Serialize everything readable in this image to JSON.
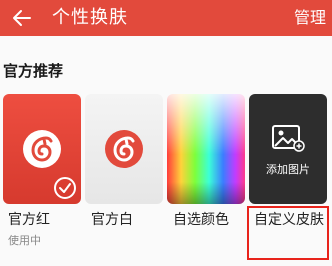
{
  "appbar": {
    "title": "个性换肤",
    "manage_label": "管理",
    "back_icon": "arrow-left-icon",
    "background_color": "#e24a3c"
  },
  "section": {
    "title": "官方推荐"
  },
  "skins": [
    {
      "label": "官方红",
      "status": "使用中",
      "selected": true,
      "icon": "netease-music-logo-icon"
    },
    {
      "label": "官方白",
      "icon": "netease-music-logo-icon"
    },
    {
      "label": "自选颜色",
      "icon": "color-spectrum"
    },
    {
      "label": "自定义皮肤",
      "action_label": "添加图片",
      "icon": "add-image-icon"
    }
  ],
  "colors": {
    "brand_red": "#e24a3c",
    "highlight": "#e8231b"
  }
}
